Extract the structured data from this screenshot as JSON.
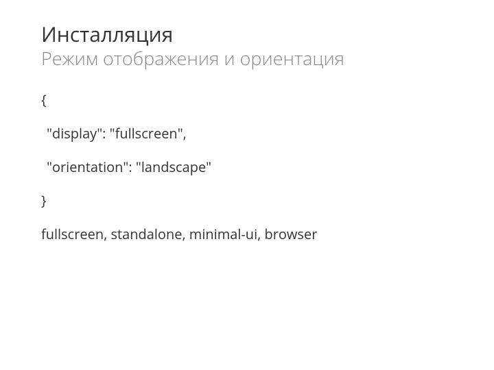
{
  "header": {
    "title": "Инсталляция",
    "subtitle": "Режим отображения и ориентация"
  },
  "code": {
    "open": "{",
    "line1": "\"display\": \"fullscreen\",",
    "line2": "\"orientation\": \"landscape\"",
    "close": "}"
  },
  "footnote": "fullscreen, standalone, minimal-ui, browser"
}
